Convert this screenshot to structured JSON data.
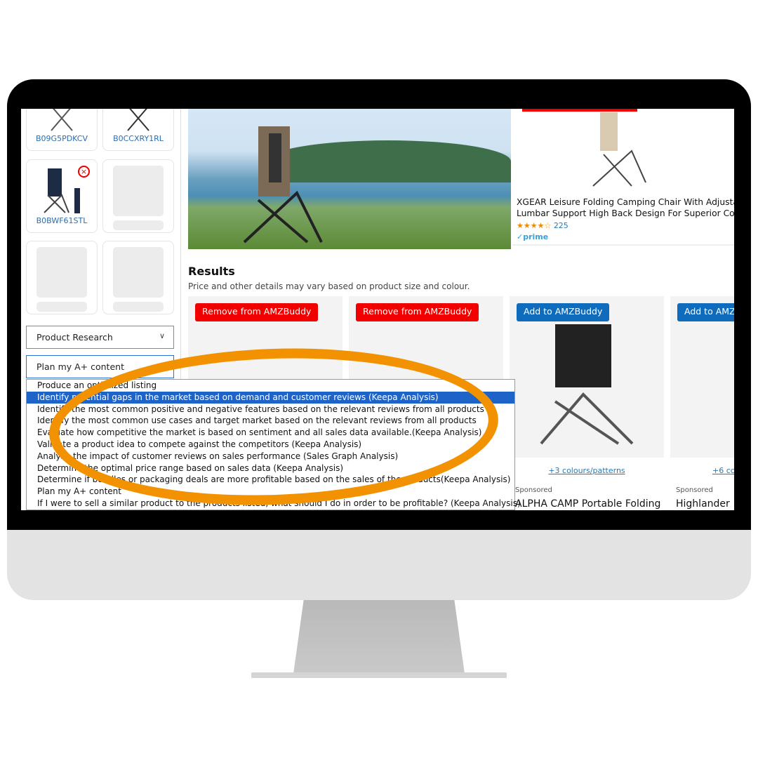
{
  "sidebar": {
    "tiles": [
      {
        "asin": "B09G5PDKCV"
      },
      {
        "asin": "B0CCXRY1RL"
      },
      {
        "asin": "B0BWF61STL"
      }
    ],
    "select1": {
      "value": "Product Research"
    },
    "select2": {
      "value": "Plan my A+ content"
    },
    "dropdown_options": [
      "Produce an optimized listing",
      "Identify potential gaps in the market based on demand and customer reviews (Keepa Analysis)",
      "Identify the most common positive and negative features based on the relevant reviews from all products",
      "Identify the most common use cases and target market based on the relevant reviews from all products",
      "Evaluate how competitive the market is based on sentiment and all sales data available.(Keepa Analysis)",
      "Validate a product idea to compete against the competitors (Keepa Analysis)",
      "Analyse the impact of customer reviews on sales performance (Sales Graph Analysis)",
      "Determine the optimal price range based on sales data (Keepa Analysis)",
      "Determine if bundles or packaging deals are more profitable based on the sales of the products(Keepa Analysis)",
      "Plan my A+ content",
      "If I were to sell a similar product to the products listed, what should I do in order to be profitable? (Keepa Analysis)"
    ],
    "highlighted_option": 1
  },
  "featured": {
    "title_line1": "XGEAR Leisure Folding Camping Chair With Adjustabl",
    "title_line2": "Lumbar Support High Back Design For Superior Com.",
    "stars": "★★★★☆",
    "rating": 4.5,
    "reviews": "225",
    "prime": "✓prime"
  },
  "results": {
    "heading": "Results",
    "subtitle": "Price and other details may vary based on product size and colour.",
    "products": [
      {
        "button": "Remove from AMZBuddy",
        "button_color": "#f20000"
      },
      {
        "button": "Remove from AMZBuddy",
        "button_color": "#f20000"
      },
      {
        "button": "Add to AMZBuddy",
        "button_color": "#0f6cbd",
        "variants": "+3 colours/patterns",
        "sponsored": "Sponsored",
        "title": "ALPHA CAMP Portable Folding"
      },
      {
        "button": "Add to AMZ",
        "button_color": "#0f6cbd",
        "variants": "+6 cc",
        "sponsored": "Sponsored",
        "title": "Highlander"
      }
    ]
  },
  "annotation_color": "#f39200"
}
